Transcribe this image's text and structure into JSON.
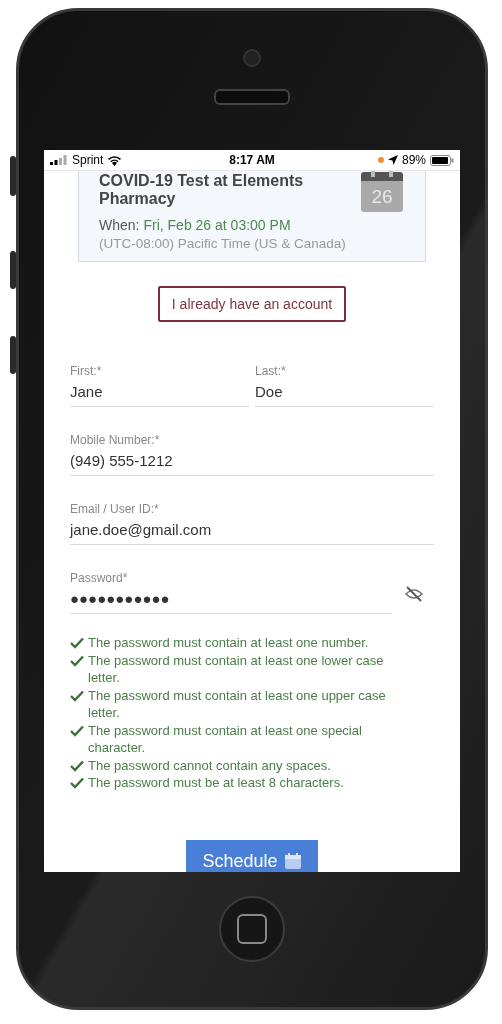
{
  "status_bar": {
    "carrier": "Sprint",
    "time": "8:17 AM",
    "battery": "89%"
  },
  "appointment": {
    "title": "COVID-19 Test at Elements Pharmacy",
    "when_label": "When:",
    "when_value": "Fri, Feb 26 at 03:00 PM",
    "timezone": "(UTC-08:00) Pacific Time (US & Canada)",
    "calendar_day": "26"
  },
  "account_button": "I already have an account",
  "name_fields": [
    {
      "label": "First:*",
      "value": "Jane"
    },
    {
      "label": "Last:*",
      "value": "Doe"
    }
  ],
  "fields": [
    {
      "label": "Mobile Number:*",
      "value": "(949) 555-1212",
      "kind": "text"
    },
    {
      "label": "Email / User ID:*",
      "value": "jane.doe@gmail.com",
      "kind": "text"
    },
    {
      "label": "Password*",
      "value": "●●●●●●●●●●●",
      "kind": "password"
    }
  ],
  "requirements": [
    {
      "text": "The password must contain at least one number.",
      "met": true
    },
    {
      "text": "The password must contain at least one lower case letter.",
      "met": true
    },
    {
      "text": "The password must contain at least one upper case letter.",
      "met": true
    },
    {
      "text": "The password must contain at least one special character.",
      "met": true
    },
    {
      "text": "The password cannot contain any spaces.",
      "met": true
    },
    {
      "text": "The password must be at least 8 characters.",
      "met": true
    }
  ],
  "schedule_button": "Schedule"
}
